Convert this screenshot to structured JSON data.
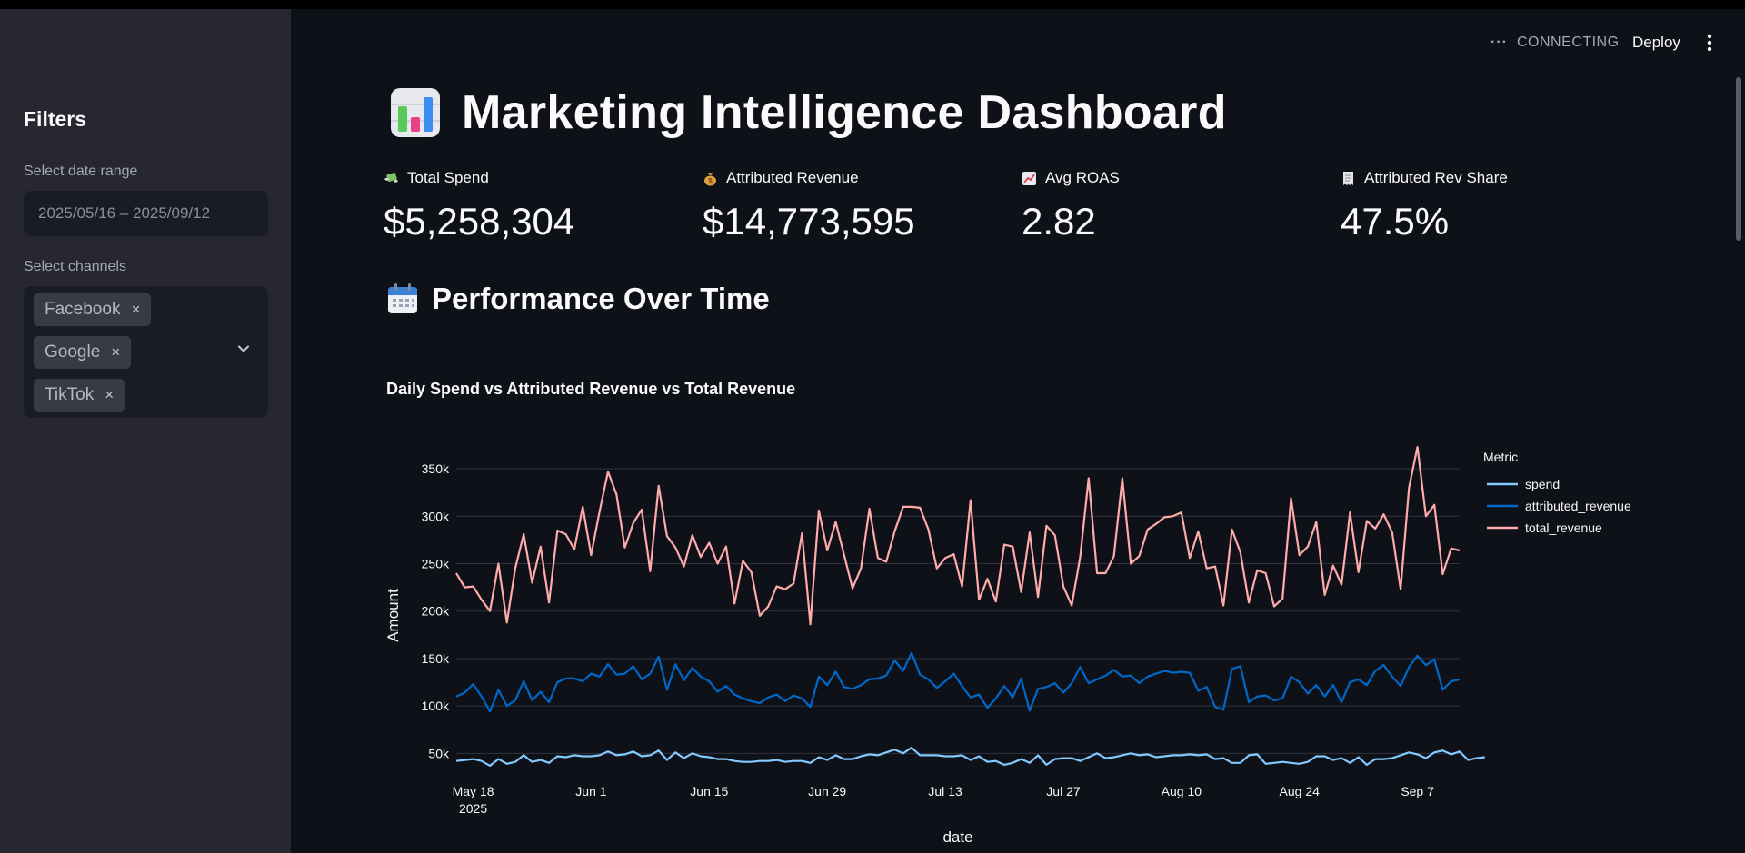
{
  "sidebar": {
    "title": "Filters",
    "date_label": "Select date range",
    "date_value": "2025/05/16 – 2025/09/12",
    "channels_label": "Select channels",
    "channels": [
      "Facebook",
      "Google",
      "TikTok"
    ],
    "remove_glyph": "×"
  },
  "header": {
    "status": "CONNECTING",
    "deploy_label": "Deploy"
  },
  "main": {
    "title": "Marketing Intelligence Dashboard",
    "title_icon": "bar-chart-icon",
    "metrics": [
      {
        "label": "Total Spend",
        "value": "$5,258,304",
        "icon": "money-with-wings-icon"
      },
      {
        "label": "Attributed Revenue",
        "value": "$14,773,595",
        "icon": "money-bag-icon"
      },
      {
        "label": "Avg ROAS",
        "value": "2.82",
        "icon": "chart-increasing-icon"
      },
      {
        "label": "Attributed Rev Share",
        "value": "47.5%",
        "icon": "receipt-icon"
      }
    ],
    "section_title": "Performance Over Time",
    "section_icon": "calendar-icon"
  },
  "chart_data": {
    "type": "line",
    "title": "Daily Spend vs Attributed Revenue vs Total Revenue",
    "xlabel": "date",
    "ylabel": "Amount",
    "x_start": "2025-05-16",
    "x_end": "2025-09-12",
    "x_ticks": [
      {
        "date": "2025-05-18",
        "label": "May 18",
        "sublabel": "2025"
      },
      {
        "date": "2025-06-01",
        "label": "Jun 1"
      },
      {
        "date": "2025-06-15",
        "label": "Jun 15"
      },
      {
        "date": "2025-06-29",
        "label": "Jun 29"
      },
      {
        "date": "2025-07-13",
        "label": "Jul 13"
      },
      {
        "date": "2025-07-27",
        "label": "Jul 27"
      },
      {
        "date": "2025-08-10",
        "label": "Aug 10"
      },
      {
        "date": "2025-08-24",
        "label": "Aug 24"
      },
      {
        "date": "2025-09-07",
        "label": "Sep 7"
      }
    ],
    "y_ticks": [
      {
        "value": 50000,
        "label": "50k"
      },
      {
        "value": 100000,
        "label": "100k"
      },
      {
        "value": 150000,
        "label": "150k"
      },
      {
        "value": 200000,
        "label": "200k"
      },
      {
        "value": 250000,
        "label": "250k"
      },
      {
        "value": 300000,
        "label": "300k"
      },
      {
        "value": 350000,
        "label": "350k"
      }
    ],
    "ylim": [
      35000,
      375000
    ],
    "grid": true,
    "legend_title": "Metric",
    "legend_position": "right",
    "series": [
      {
        "name": "spend",
        "color": "#83c9ff",
        "values": [
          42000,
          43000,
          44000,
          42000,
          37000,
          44000,
          39000,
          41000,
          48000,
          41000,
          43000,
          40000,
          47000,
          46000,
          48000,
          47000,
          47000,
          48000,
          52000,
          48000,
          49000,
          52000,
          47000,
          48000,
          53000,
          43000,
          51000,
          45000,
          50000,
          47000,
          46000,
          44000,
          44000,
          42000,
          41000,
          41000,
          42000,
          42000,
          43000,
          41000,
          42000,
          42000,
          40000,
          46000,
          43000,
          48000,
          44000,
          44000,
          47000,
          49000,
          48000,
          51000,
          54000,
          50000,
          56000,
          48000,
          48000,
          48000,
          47000,
          47000,
          48000,
          43000,
          47000,
          41000,
          42000,
          38000,
          40000,
          44000,
          40000,
          48000,
          38000,
          44000,
          45000,
          45000,
          42000,
          46000,
          50000,
          45000,
          46000,
          48000,
          50000,
          48000,
          49000,
          46000,
          47000,
          48000,
          48000,
          49000,
          48000,
          49000,
          44000,
          45000,
          40000,
          40000,
          48000,
          49000,
          39000,
          40000,
          41000,
          40000,
          39000,
          41000,
          47000,
          47000,
          43000,
          45000,
          40000,
          46000,
          38000,
          44000,
          44000,
          45000,
          48000,
          51000,
          49000,
          45000,
          51000,
          53000,
          49000,
          52000,
          43000,
          45000,
          46000
        ],
        "note_not_display": ""
      },
      {
        "name": "attributed_revenue",
        "color": "#0068c9",
        "values": [
          110000,
          114000,
          123000,
          110000,
          94000,
          117000,
          100000,
          106000,
          126000,
          106000,
          115000,
          104000,
          125000,
          129000,
          129000,
          126000,
          134000,
          131000,
          144000,
          133000,
          134000,
          142000,
          128000,
          134000,
          152000,
          117000,
          144000,
          127000,
          140000,
          131000,
          126000,
          115000,
          121000,
          112000,
          108000,
          105000,
          103000,
          109000,
          112000,
          105000,
          111000,
          108000,
          99000,
          131000,
          122000,
          136000,
          120000,
          118000,
          122000,
          128000,
          129000,
          132000,
          148000,
          137000,
          156000,
          133000,
          128000,
          119000,
          126000,
          134000,
          121000,
          109000,
          112000,
          98000,
          108000,
          121000,
          109000,
          129000,
          95000,
          118000,
          120000,
          124000,
          114000,
          124000,
          141000,
          124000,
          128000,
          132000,
          138000,
          131000,
          132000,
          124000,
          131000,
          134000,
          137000,
          135000,
          136000,
          135000,
          116000,
          120000,
          99000,
          96000,
          139000,
          142000,
          104000,
          110000,
          111000,
          106000,
          108000,
          131000,
          125000,
          113000,
          122000,
          110000,
          122000,
          104000,
          125000,
          128000,
          122000,
          137000,
          143000,
          131000,
          121000,
          141000,
          153000,
          143000,
          149000,
          117000,
          126000,
          128000
        ]
      },
      {
        "name": "total_revenue",
        "color": "#ffabab",
        "values": [
          240000,
          225000,
          226000,
          212000,
          200000,
          250000,
          188000,
          245000,
          281000,
          230000,
          268000,
          209000,
          285000,
          281000,
          265000,
          310000,
          259000,
          305000,
          347000,
          323000,
          267000,
          293000,
          307000,
          242000,
          332000,
          279000,
          267000,
          247000,
          280000,
          257000,
          272000,
          250000,
          268000,
          208000,
          253000,
          241000,
          195000,
          205000,
          226000,
          223000,
          229000,
          282000,
          186000,
          306000,
          264000,
          294000,
          259000,
          224000,
          245000,
          308000,
          256000,
          252000,
          284000,
          310000,
          310000,
          309000,
          286000,
          245000,
          256000,
          260000,
          226000,
          317000,
          212000,
          234000,
          210000,
          270000,
          268000,
          220000,
          283000,
          215000,
          290000,
          280000,
          226000,
          206000,
          257000,
          340000,
          240000,
          240000,
          258000,
          340000,
          250000,
          258000,
          286000,
          292000,
          299000,
          300000,
          304000,
          256000,
          284000,
          245000,
          247000,
          206000,
          286000,
          262000,
          209000,
          243000,
          240000,
          205000,
          213000,
          319000,
          259000,
          268000,
          294000,
          217000,
          248000,
          228000,
          304000,
          241000,
          295000,
          287000,
          302000,
          283000,
          223000,
          330000,
          373000,
          300000,
          312000,
          239000,
          266000,
          264000
        ]
      }
    ]
  }
}
